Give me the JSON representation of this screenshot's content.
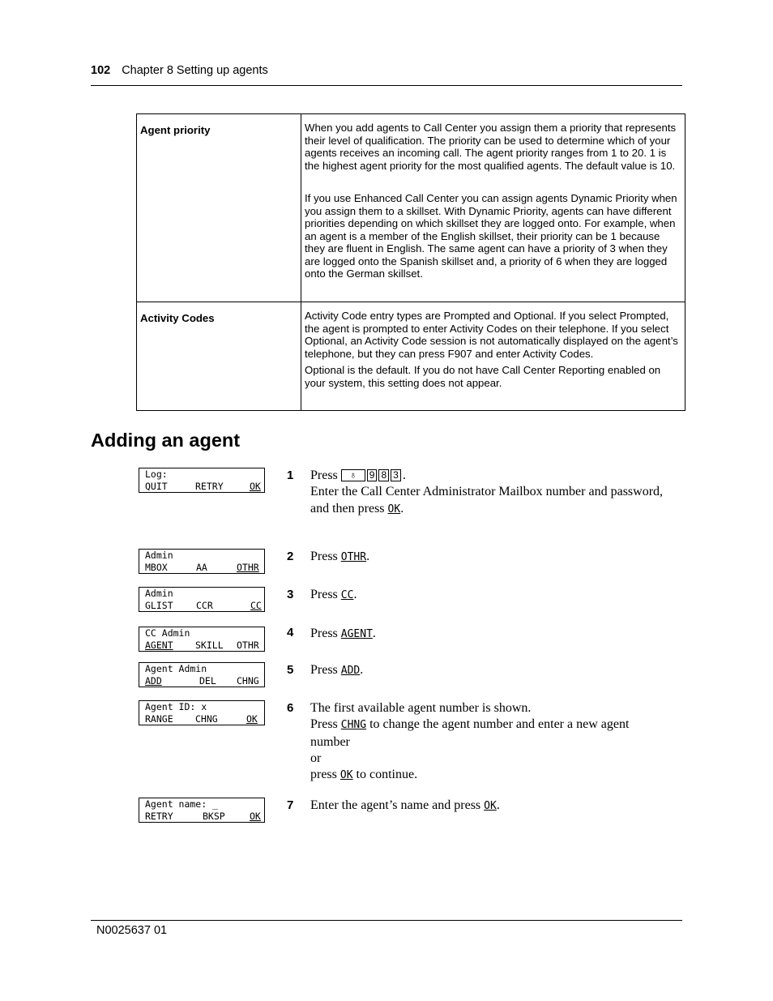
{
  "header": {
    "page_number": "102",
    "chapter": "Chapter 8  Setting up agents"
  },
  "table": {
    "rows": [
      {
        "term": "Agent priority",
        "paragraphs": [
          "When you add agents to Call Center you assign them a priority that represents their level of qualification. The priority can be used to determine which of your agents receives an incoming call. The agent priority ranges from 1 to 20. 1 is the highest agent priority for the most qualified agents. The default value is 10.",
          "If you use Enhanced Call Center you can assign agents Dynamic Priority when you assign them to a skillset. With Dynamic Priority, agents can have different priorities depending on which skillset they are logged onto. For example, when an agent is a member of the English skillset, their priority can be 1 because they are fluent in English. The same agent can have a priority of 3 when they are logged onto the Spanish skillset and, a priority of 6 when they are logged onto the German skillset."
        ]
      },
      {
        "term": "Activity Codes",
        "paragraphs": [
          "Activity Code entry types are Prompted and Optional. If you select Prompted, the agent is prompted to enter Activity Codes on their telephone. If you select Optional, an Activity Code session is not automatically displayed on the agent’s telephone, but they can press F907 and enter Activity Codes.",
          "Optional is the default. If you do not have Call Center Reporting enabled on your system, this setting does not appear."
        ]
      }
    ]
  },
  "section_title": "Adding an agent",
  "steps": [
    {
      "num": "1",
      "lcd": {
        "line1": "Log:",
        "softkeys": [
          "QUIT",
          "RETRY",
          "OK"
        ],
        "underlined": [
          2
        ]
      },
      "press": "Press",
      "keys": [
        "feature",
        "9",
        "8",
        "3"
      ],
      "after_keys": ".",
      "line2": "Enter the Call Center Administrator Mailbox number and password,",
      "line3_prefix": "and then press",
      "line3_key": "OK",
      "line3_suffix": "."
    },
    {
      "num": "2",
      "lcd": {
        "line1": "Admin",
        "softkeys": [
          "MBOX",
          "AA",
          "OTHR"
        ],
        "underlined": [
          2
        ]
      },
      "prefix": "Press",
      "key": "OTHR",
      "suffix": "."
    },
    {
      "num": "3",
      "lcd": {
        "line1": "Admin",
        "softkeys": [
          "GLIST",
          "CCR",
          "CC"
        ],
        "underlined": [
          2
        ]
      },
      "prefix": "Press",
      "key": "CC",
      "suffix": "."
    },
    {
      "num": "4",
      "lcd": {
        "line1": "CC Admin",
        "softkeys": [
          "AGENT",
          "SKILL",
          "OTHR"
        ],
        "underlined": [
          0
        ]
      },
      "prefix": "Press",
      "key": "AGENT",
      "suffix": "."
    },
    {
      "num": "5",
      "lcd": {
        "line1": "Agent Admin",
        "softkeys": [
          "ADD",
          "DEL",
          "CHNG"
        ],
        "underlined": [
          0
        ]
      },
      "prefix": "Press",
      "key": "ADD",
      "suffix": "."
    },
    {
      "num": "6",
      "lcd": {
        "line1": "Agent ID: x",
        "softkeys": [
          "RANGE",
          "CHNG",
          "OK"
        ],
        "underlined": [
          2
        ]
      },
      "line1": "The first available agent number is shown.",
      "line2_prefix": "Press",
      "line2_key": "CHNG",
      "line2_suffix": "to change the agent number and enter a new agent number",
      "line3": "or",
      "line4_prefix": "press",
      "line4_key": "OK",
      "line4_suffix": "to continue."
    },
    {
      "num": "7",
      "lcd": {
        "line1": "Agent name: _",
        "softkeys": [
          "RETRY",
          "BKSP",
          "OK"
        ],
        "underlined": [
          2
        ]
      },
      "prefix": "Enter the agent’s name and press",
      "key": "OK",
      "suffix": "."
    }
  ],
  "icons": {
    "feature_key": "feature-key-icon"
  },
  "footer": {
    "doc_number": "N0025637 01"
  }
}
